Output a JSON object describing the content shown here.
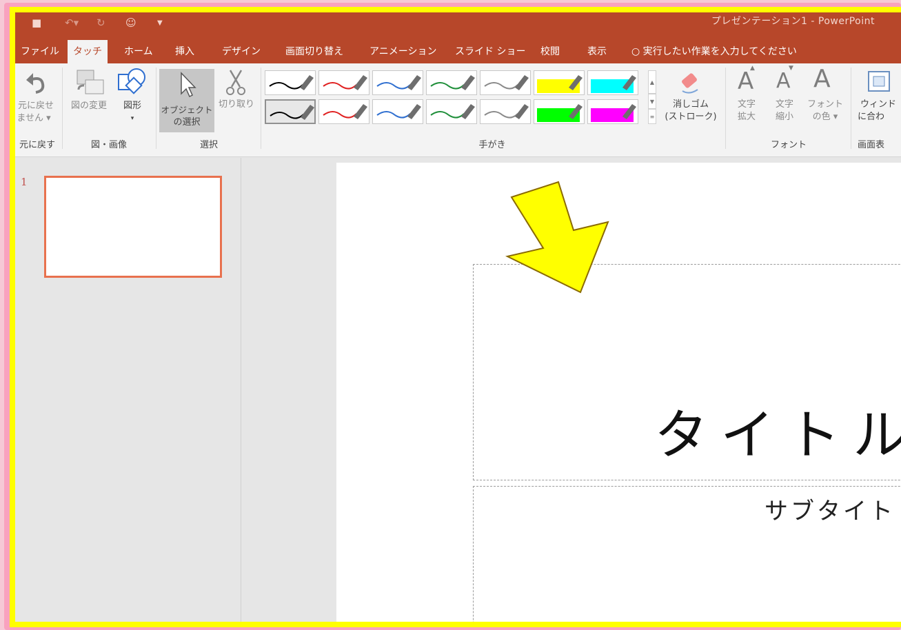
{
  "window": {
    "title": "プレゼンテーション1 - PowerPoint"
  },
  "tabs": [
    {
      "label": "ファイル"
    },
    {
      "label": "タッチ"
    },
    {
      "label": "ホーム"
    },
    {
      "label": "挿入"
    },
    {
      "label": "デザイン"
    },
    {
      "label": "画面切り替え"
    },
    {
      "label": "アニメーション"
    },
    {
      "label": "スライド ショー"
    },
    {
      "label": "校閲"
    },
    {
      "label": "表示"
    }
  ],
  "tellme": {
    "label": "実行したい作業を入力してください"
  },
  "ribbon": {
    "undo": {
      "line1": "元に戻せ",
      "line2": "ません ▾",
      "group": "元に戻す"
    },
    "picture": {
      "change_label": "図の変更",
      "shape_line1": "図形",
      "shape_line2": "▾",
      "group": "図・画像"
    },
    "select": {
      "object_line1": "オブジェクト",
      "object_line2": "の選択",
      "cut_label": "切り取り",
      "group": "選択"
    },
    "ink": {
      "group": "手がき",
      "pens_row1": [
        "#000000",
        "#e02020",
        "#2f6fd0",
        "#1f8f3a",
        "#8a8a8a",
        "#ffff00",
        "#00ffff"
      ],
      "pens_row2": [
        "#000000",
        "#e02020",
        "#2f6fd0",
        "#1f8f3a",
        "#8a8a8a",
        "#00ff00",
        "#ff00ff"
      ],
      "eraser_line1": "消しゴム",
      "eraser_line2": "(ストローク)"
    },
    "font": {
      "grow_line1": "文字",
      "grow_line2": "拡大",
      "shrink_line1": "文字",
      "shrink_line2": "縮小",
      "color_line1": "フォント",
      "color_line2": "の色 ▾",
      "group": "フォント"
    },
    "view": {
      "line1": "ウィンド",
      "line2": "に合わ",
      "group": "画面表"
    }
  },
  "thumbnails": {
    "slide_number": "1"
  },
  "slide": {
    "title": "タイトル",
    "subtitle": "サブタイト"
  },
  "colors": {
    "accent": "#b7472a",
    "highlight_frame": "#ffff00",
    "annotation_arrow": "#ffff00"
  }
}
